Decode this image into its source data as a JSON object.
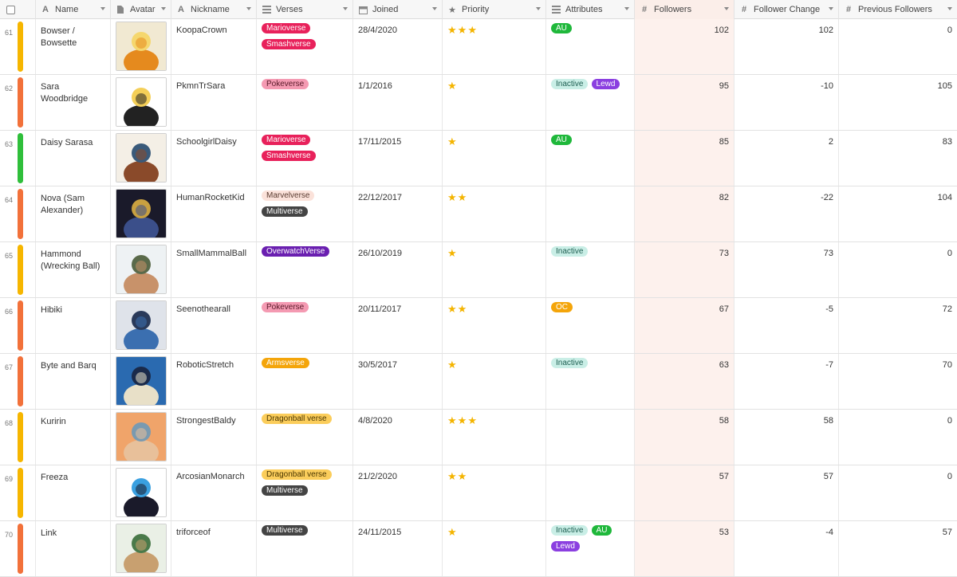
{
  "headers": {
    "name": "Name",
    "avatar": "Avatar",
    "nickname": "Nickname",
    "verses": "Verses",
    "joined": "Joined",
    "priority": "Priority",
    "attributes": "Attributes",
    "followers": "Followers",
    "follower_change": "Follower Change",
    "previous_followers": "Previous Followers"
  },
  "colors": {
    "bar_yellow": "#f6b600",
    "bar_orange": "#f2713a",
    "bar_green": "#2fbf3b",
    "star": "#f4b400",
    "followers_bg": "#fdf1ed"
  },
  "tag_styles": {
    "Marioverse": {
      "bg": "#e8215b",
      "fg": "#ffffff"
    },
    "Smashverse": {
      "bg": "#e8215b",
      "fg": "#ffffff"
    },
    "Pokeverse": {
      "bg": "#f49ab2",
      "fg": "#5a1a2a"
    },
    "Marvelverse": {
      "bg": "#fbe2da",
      "fg": "#5a3b30"
    },
    "Multiverse": {
      "bg": "#444444",
      "fg": "#ffffff"
    },
    "OverwatchVerse": {
      "bg": "#6a1fb0",
      "fg": "#ffffff"
    },
    "Armsverse": {
      "bg": "#f4a50a",
      "fg": "#ffffff"
    },
    "Dragonball verse": {
      "bg": "#fbcd5b",
      "fg": "#4a3600"
    },
    "AU": {
      "bg": "#1fb83b",
      "fg": "#ffffff"
    },
    "Inactive": {
      "bg": "#c9eee6",
      "fg": "#1f5f52"
    },
    "Lewd": {
      "bg": "#8b3fe0",
      "fg": "#ffffff"
    },
    "OC": {
      "bg": "#f4a50a",
      "fg": "#ffffff"
    }
  },
  "rows": [
    {
      "num": "61",
      "bar": "bar_yellow",
      "name": "Bowser / Bowsette",
      "avatar_icon": "bowser-avatar-icon",
      "avatar_colors": [
        "#f1e9d2",
        "#e58a1e",
        "#f5d76e"
      ],
      "nickname": "KoopaCrown",
      "verses": [
        "Marioverse",
        "Smashverse"
      ],
      "joined": "28/4/2020",
      "priority": 3,
      "attributes": [
        "AU"
      ],
      "followers": "102",
      "follower_change": "102",
      "previous_followers": "0"
    },
    {
      "num": "62",
      "bar": "bar_orange",
      "name": "Sara Woodbridge",
      "avatar_icon": "sara-avatar-icon",
      "avatar_colors": [
        "#ffffff",
        "#222222",
        "#f4cf58"
      ],
      "nickname": "PkmnTrSara",
      "verses": [
        "Pokeverse"
      ],
      "joined": "1/1/2016",
      "priority": 1,
      "attributes": [
        "Inactive",
        "Lewd"
      ],
      "followers": "95",
      "follower_change": "-10",
      "previous_followers": "105"
    },
    {
      "num": "63",
      "bar": "bar_green",
      "name": "Daisy Sarasa",
      "avatar_icon": "daisy-avatar-icon",
      "avatar_colors": [
        "#f4efe6",
        "#8a4a2a",
        "#3a5a7a"
      ],
      "nickname": "SchoolgirlDaisy",
      "verses": [
        "Marioverse",
        "Smashverse"
      ],
      "joined": "17/11/2015",
      "priority": 1,
      "attributes": [
        "AU"
      ],
      "followers": "85",
      "follower_change": "2",
      "previous_followers": "83"
    },
    {
      "num": "64",
      "bar": "bar_orange",
      "name": "Nova (Sam Alexander)",
      "avatar_icon": "nova-avatar-icon",
      "avatar_colors": [
        "#1a1a2a",
        "#3b4f8a",
        "#c8a040"
      ],
      "nickname": "HumanRocketKid",
      "verses": [
        "Marvelverse",
        "Multiverse"
      ],
      "joined": "22/12/2017",
      "priority": 2,
      "attributes": [],
      "followers": "82",
      "follower_change": "-22",
      "previous_followers": "104"
    },
    {
      "num": "65",
      "bar": "bar_yellow",
      "name": "Hammond (Wrecking Ball)",
      "avatar_icon": "hammond-avatar-icon",
      "avatar_colors": [
        "#eef2f4",
        "#c8926a",
        "#5a6a4a"
      ],
      "nickname": "SmallMammalBall",
      "verses": [
        "OverwatchVerse"
      ],
      "joined": "26/10/2019",
      "priority": 1,
      "attributes": [
        "Inactive"
      ],
      "followers": "73",
      "follower_change": "73",
      "previous_followers": "0"
    },
    {
      "num": "66",
      "bar": "bar_orange",
      "name": "Hibiki",
      "avatar_icon": "hibiki-avatar-icon",
      "avatar_colors": [
        "#dfe3ea",
        "#3b6fb0",
        "#2a3a5a"
      ],
      "nickname": "Seenothearall",
      "verses": [
        "Pokeverse"
      ],
      "joined": "20/11/2017",
      "priority": 2,
      "attributes": [
        "OC"
      ],
      "followers": "67",
      "follower_change": "-5",
      "previous_followers": "72"
    },
    {
      "num": "67",
      "bar": "bar_orange",
      "name": "Byte and Barq",
      "avatar_icon": "byte-barq-avatar-icon",
      "avatar_colors": [
        "#2a6ab0",
        "#e8e0c8",
        "#1a2a4a"
      ],
      "nickname": "RoboticStretch",
      "verses": [
        "Armsverse"
      ],
      "joined": "30/5/2017",
      "priority": 1,
      "attributes": [
        "Inactive"
      ],
      "followers": "63",
      "follower_change": "-7",
      "previous_followers": "70"
    },
    {
      "num": "68",
      "bar": "bar_yellow",
      "name": "Kuririn",
      "avatar_icon": "kuririn-avatar-icon",
      "avatar_colors": [
        "#f0a46a",
        "#e8c09a",
        "#7a9ab0"
      ],
      "nickname": "StrongestBaldy",
      "verses": [
        "Dragonball verse"
      ],
      "joined": "4/8/2020",
      "priority": 3,
      "attributes": [],
      "followers": "58",
      "follower_change": "58",
      "previous_followers": "0"
    },
    {
      "num": "69",
      "bar": "bar_yellow",
      "name": "Freeza",
      "avatar_icon": "freeza-avatar-icon",
      "avatar_colors": [
        "#ffffff",
        "#1a1a2a",
        "#3aa0e0"
      ],
      "nickname": "ArcosianMonarch",
      "verses": [
        "Dragonball verse",
        "Multiverse"
      ],
      "joined": "21/2/2020",
      "priority": 2,
      "attributes": [],
      "followers": "57",
      "follower_change": "57",
      "previous_followers": "0"
    },
    {
      "num": "70",
      "bar": "bar_orange",
      "name": "Link",
      "avatar_icon": "link-avatar-icon",
      "avatar_colors": [
        "#eaf0e6",
        "#c8a070",
        "#4a7a4a"
      ],
      "nickname": "triforceof",
      "verses": [
        "Multiverse"
      ],
      "joined": "24/11/2015",
      "priority": 1,
      "attributes": [
        "Inactive",
        "AU",
        "Lewd"
      ],
      "followers": "53",
      "follower_change": "-4",
      "previous_followers": "57"
    }
  ]
}
